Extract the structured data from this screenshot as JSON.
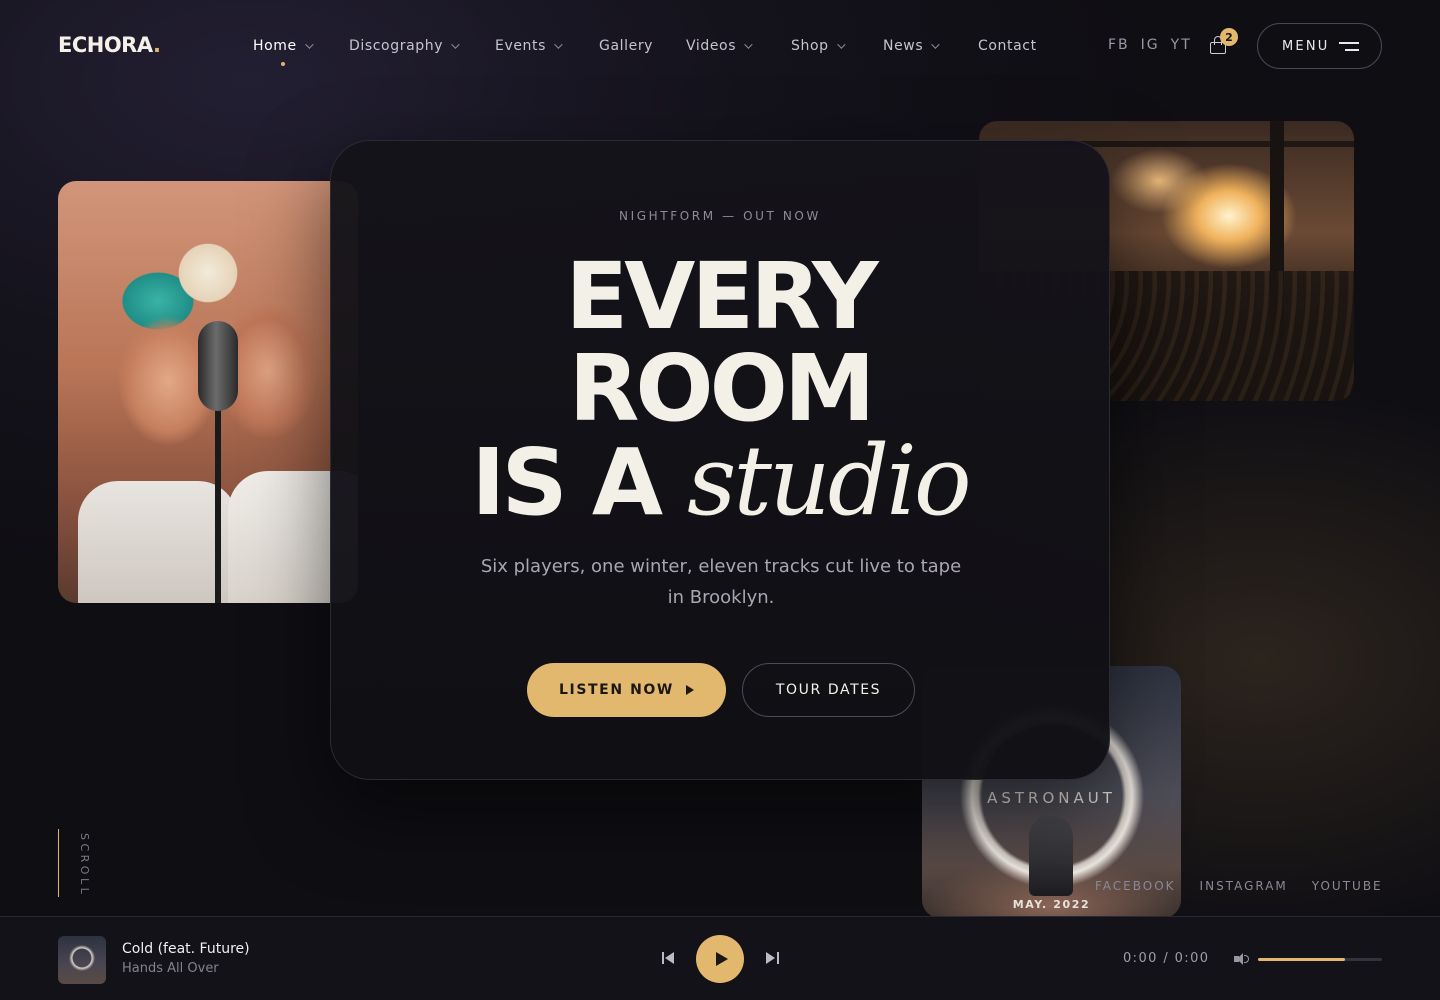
{
  "brand": {
    "name": "ECHORA",
    "dot": "."
  },
  "nav": {
    "items": [
      {
        "label": "Home",
        "has_dropdown": true,
        "active": true
      },
      {
        "label": "Discography",
        "has_dropdown": true
      },
      {
        "label": "Events",
        "has_dropdown": true
      },
      {
        "label": "Gallery",
        "has_dropdown": false
      },
      {
        "label": "Videos",
        "has_dropdown": true
      },
      {
        "label": "Shop",
        "has_dropdown": true
      },
      {
        "label": "News",
        "has_dropdown": true
      },
      {
        "label": "Contact",
        "has_dropdown": false
      }
    ]
  },
  "social_top": [
    "FB",
    "IG",
    "YT"
  ],
  "cart": {
    "count": "2"
  },
  "menu_button": {
    "label": "MENU"
  },
  "hero": {
    "eyebrow": "NIGHTFORM — OUT NOW",
    "line1": "EVERY",
    "line2": "ROOM",
    "line3_bold": "IS A",
    "line3_italic": "studio",
    "subtext": "Six players, one winter, eleven tracks cut live to tape in Brooklyn.",
    "primary_cta": "LISTEN NOW",
    "secondary_cta": "TOUR DATES"
  },
  "album_card": {
    "title": "ASTRONAUT",
    "date": "MAY. 2022"
  },
  "scroll_label": "SCROLL",
  "social_bottom": [
    "FACEBOOK",
    "INSTAGRAM",
    "YOUTUBE"
  ],
  "player": {
    "title": "Cold (feat. Future)",
    "artist": "Hands All Over",
    "time": "0:00 / 0:00",
    "volume": 0.7
  },
  "colors": {
    "accent": "#e2b86e",
    "background": "#14121b",
    "text": "#f3f0e8"
  }
}
